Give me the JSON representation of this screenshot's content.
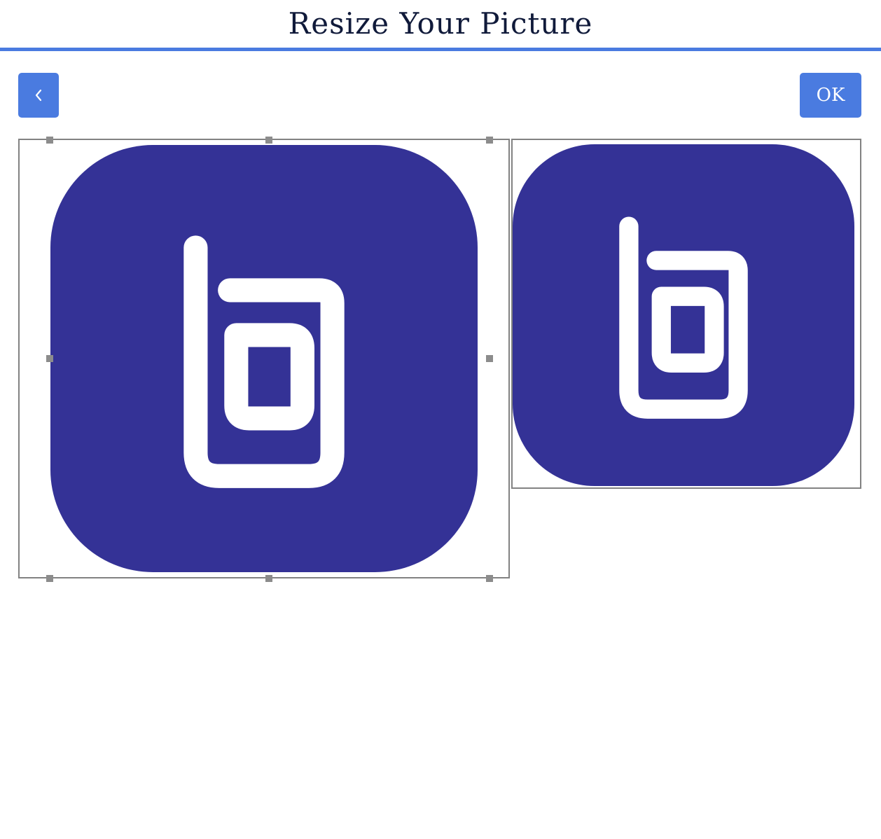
{
  "header": {
    "title": "Resize Your Picture"
  },
  "toolbar": {
    "back_icon": "chevron-left-icon",
    "ok_label": "OK"
  },
  "colors": {
    "accent": "#4a7be0",
    "logo_background": "#343296",
    "logo_foreground": "#ffffff",
    "title_text": "#101a3a",
    "frame_border": "#828282"
  },
  "crop_editor": {
    "image_icon": "app-logo-icon",
    "handle_icon": "resize-handle-icon"
  },
  "preview": {
    "image_icon": "app-logo-icon"
  }
}
